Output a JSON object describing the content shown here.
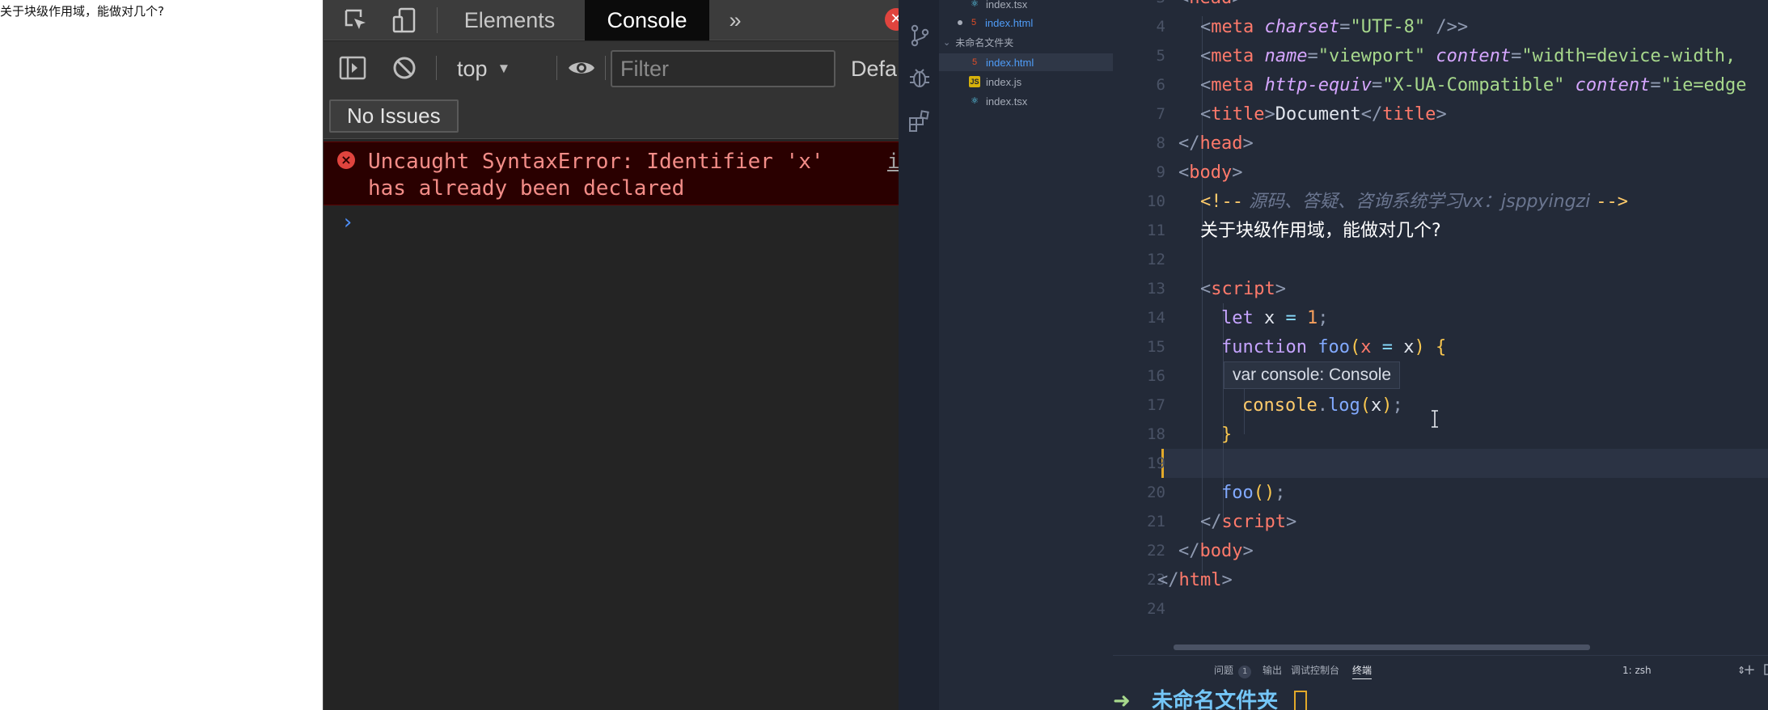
{
  "page": {
    "text": "关于块级作用域，能做对几个?"
  },
  "devtools": {
    "tabs": [
      "Elements",
      "Console"
    ],
    "active_tab": "Console",
    "more_tabs_glyph": "»",
    "close_glyph": "✕",
    "context": "top",
    "filter_placeholder": "Filter",
    "levels_label": "Defa",
    "issues_button": "No Issues",
    "error": {
      "message": "Uncaught SyntaxError: Identifier 'x' has already been declared",
      "source": "i"
    },
    "prompt_glyph": "›"
  },
  "explorer": {
    "files_top": [
      {
        "name": "index.tsx",
        "icon": "react-icon"
      },
      {
        "name": "index.html",
        "icon": "html-icon",
        "modified": true,
        "active": true
      }
    ],
    "folder": "未命名文件夹",
    "folder_files": [
      {
        "name": "index.html",
        "icon": "html-icon",
        "selected": true
      },
      {
        "name": "index.js",
        "icon": "js-icon",
        "icon_text": "JS"
      },
      {
        "name": "index.tsx",
        "icon": "react-icon"
      }
    ]
  },
  "editor": {
    "line_numbers": [
      "3",
      "4",
      "5",
      "6",
      "7",
      "8",
      "9",
      "10",
      "11",
      "12",
      "13",
      "14",
      "15",
      "16",
      "17",
      "18",
      "19",
      "20",
      "21",
      "22",
      "23",
      "24"
    ],
    "text": {
      "head_open": "head",
      "meta": "meta",
      "charset": "charset",
      "eq": "=",
      "charset_val": "\"UTF-8\"",
      "self_close": " />",
      "name_attr": "name",
      "viewport": "\"viewport\"",
      "content_attr": "content",
      "content_val": "\"width=device-width,",
      "http_equiv": "http-equiv",
      "xua": "\"X-UA-Compatible\"",
      "ie_edge": "\"ie=edge",
      "title": "title",
      "title_text": "Document",
      "head": "head",
      "body": "body",
      "comment_open": "<!--",
      "comment_text": " 源码、答疑、咨询系统学习vx：jsppyingzi ",
      "comment_close": "-->",
      "heading_text": "关于块级作用域，能做对几个?",
      "script": "script",
      "let": "let",
      "x": "x",
      "assign": " = ",
      "one": "1",
      "semi": ";",
      "function": "function",
      "foo": "foo",
      "open_paren": "(",
      "close_paren": ")",
      "open_brace": "{",
      "close_brace": "}",
      "console": "console",
      "dot": ".",
      "log": "log",
      "foo_call": "foo",
      "call_parens": "()",
      "html": "html"
    },
    "hover_tooltip": "var console: Console"
  },
  "panel": {
    "tabs": [
      "问题",
      "输出",
      "调试控制台",
      "终端"
    ],
    "problems_count": "1",
    "active_tab": "终端",
    "terminal_select": "1: zsh",
    "terminal_arrow": "➜",
    "terminal_dir": "未命名文件夹"
  }
}
